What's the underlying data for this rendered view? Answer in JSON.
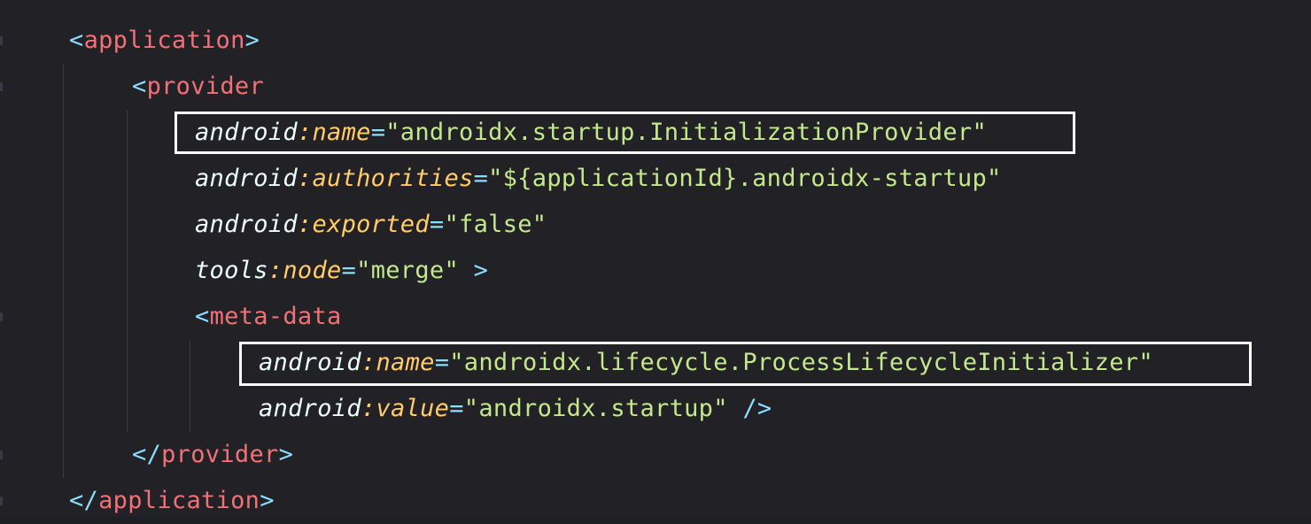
{
  "code_lines": [
    {
      "parts": [
        {
          "t": "<",
          "c": "punc"
        },
        {
          "t": "application",
          "c": "tag"
        },
        {
          "t": ">",
          "c": "punc"
        }
      ]
    },
    {
      "parts": [
        {
          "t": "<",
          "c": "punc"
        },
        {
          "t": "provider",
          "c": "tag"
        }
      ]
    },
    {
      "parts": [
        {
          "t": "android",
          "c": "ns"
        },
        {
          "t": ":",
          "c": "colon"
        },
        {
          "t": "name",
          "c": "attr"
        },
        {
          "t": "=",
          "c": "eq"
        },
        {
          "t": "\"androidx.startup.InitializationProvider\"",
          "c": "str"
        }
      ]
    },
    {
      "parts": [
        {
          "t": "android",
          "c": "ns"
        },
        {
          "t": ":",
          "c": "colon"
        },
        {
          "t": "authorities",
          "c": "attr"
        },
        {
          "t": "=",
          "c": "eq"
        },
        {
          "t": "\"${applicationId}.androidx-startup\"",
          "c": "str"
        }
      ]
    },
    {
      "parts": [
        {
          "t": "android",
          "c": "ns"
        },
        {
          "t": ":",
          "c": "colon"
        },
        {
          "t": "exported",
          "c": "attr"
        },
        {
          "t": "=",
          "c": "eq"
        },
        {
          "t": "\"false\"",
          "c": "str"
        }
      ]
    },
    {
      "parts": [
        {
          "t": "tools",
          "c": "ns"
        },
        {
          "t": ":",
          "c": "colon"
        },
        {
          "t": "node",
          "c": "attr"
        },
        {
          "t": "=",
          "c": "eq"
        },
        {
          "t": "\"merge\"",
          "c": "str"
        },
        {
          "t": " >",
          "c": "punc"
        }
      ]
    },
    {
      "parts": [
        {
          "t": "<",
          "c": "punc"
        },
        {
          "t": "meta-data",
          "c": "tag"
        }
      ]
    },
    {
      "parts": [
        {
          "t": "android",
          "c": "ns"
        },
        {
          "t": ":",
          "c": "colon"
        },
        {
          "t": "name",
          "c": "attr"
        },
        {
          "t": "=",
          "c": "eq"
        },
        {
          "t": "\"androidx.lifecycle.ProcessLifecycleInitializer\"",
          "c": "str"
        }
      ]
    },
    {
      "parts": [
        {
          "t": "android",
          "c": "ns"
        },
        {
          "t": ":",
          "c": "colon"
        },
        {
          "t": "value",
          "c": "attr"
        },
        {
          "t": "=",
          "c": "eq"
        },
        {
          "t": "\"androidx.startup\"",
          "c": "str"
        },
        {
          "t": " />",
          "c": "punc"
        }
      ]
    },
    {
      "parts": [
        {
          "t": "</",
          "c": "punc"
        },
        {
          "t": "provider",
          "c": "tag"
        },
        {
          "t": ">",
          "c": "punc"
        }
      ]
    },
    {
      "parts": [
        {
          "t": "</",
          "c": "punc"
        },
        {
          "t": "application",
          "c": "tag"
        },
        {
          "t": ">",
          "c": "punc"
        }
      ]
    }
  ],
  "highlighted_lines": [
    2,
    7
  ],
  "theme": {
    "background": "#222226",
    "tag_color": "#f07178",
    "punctuation_color": "#89ddff",
    "attribute_color": "#ffcb6b",
    "string_color": "#c3e88d",
    "namespace_color": "#eeffff",
    "highlight_border": "#ffffff"
  }
}
